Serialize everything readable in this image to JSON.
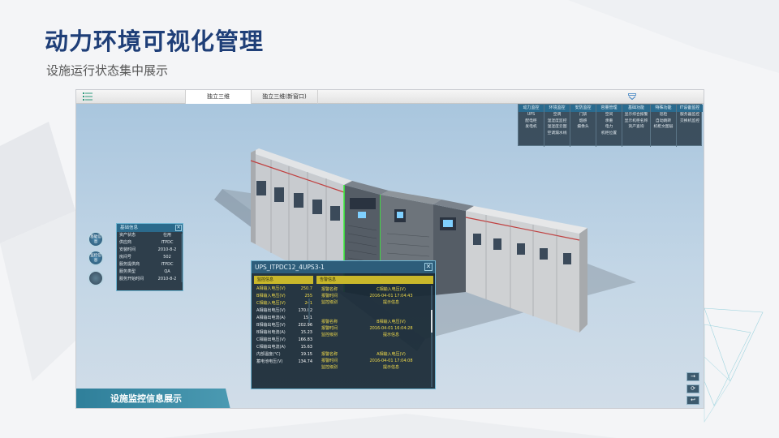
{
  "slide": {
    "title": "动力环境可视化管理",
    "subtitle": "设施运行状态集中展示"
  },
  "app": {
    "tabs": [
      {
        "label": "独立三维",
        "active": true
      },
      {
        "label": "独立三维(新窗口)",
        "active": false
      }
    ],
    "menu_icon": "list-icon",
    "collapse_icon": "chevron-down-icon",
    "topnav": [
      {
        "head": "动力监控",
        "items": [
          "UPS",
          "配电柜",
          "发电机"
        ]
      },
      {
        "head": "环境监控",
        "items": [
          "空调",
          "温湿度监控",
          "温湿度云图",
          "空调漏水线"
        ]
      },
      {
        "head": "安防监控",
        "items": [
          "门禁",
          "烟感",
          "摄像头"
        ]
      },
      {
        "head": "容量管理",
        "items": [
          "空间",
          "承重",
          "电力",
          "机柜位置"
        ]
      },
      {
        "head": "基础功能",
        "items": [
          "显示综合报警",
          "显示机柜名称",
          "资产查询"
        ]
      },
      {
        "head": "特殊功能",
        "items": [
          "巡检",
          "自动跳转",
          "机柜文图层"
        ]
      },
      {
        "head": "IT设备监控",
        "items": [
          "服务器监控",
          "交换机监控"
        ]
      }
    ],
    "basic_info": {
      "title": "基础信息",
      "rows": [
        {
          "k": "资产状态",
          "v": "在用"
        },
        {
          "k": "供应商",
          "v": "ITPDC"
        },
        {
          "k": "安装时间",
          "v": "2010-8-2"
        },
        {
          "k": "房间号",
          "v": "502"
        },
        {
          "k": "服务提供商",
          "v": "ITPDC"
        },
        {
          "k": "服务类型",
          "v": "QA"
        },
        {
          "k": "服务开始时间",
          "v": "2010-8-2"
        }
      ]
    },
    "round_buttons": [
      "基础信息",
      "监控信息",
      ""
    ],
    "ups_panel": {
      "title": "UPS_ITPDC12_4UPS3-1",
      "monitor_header": "监控信息",
      "alarm_header": "告警信息",
      "monitor_rows": [
        {
          "k": "A相输入电压(V)",
          "v": "250.7",
          "hl": true
        },
        {
          "k": "B相输入电压(V)",
          "v": "255",
          "hl": true
        },
        {
          "k": "C相输入电压(V)",
          "v": "241",
          "hl": true
        },
        {
          "k": "A相输出电压(V)",
          "v": "170.02",
          "hl": false
        },
        {
          "k": "A相输出电流(A)",
          "v": "15.1",
          "hl": false
        },
        {
          "k": "B相输出电压(V)",
          "v": "202.96",
          "hl": false
        },
        {
          "k": "B相输出电流(A)",
          "v": "15.23",
          "hl": false
        },
        {
          "k": "C相输出电压(V)",
          "v": "166.83",
          "hl": false
        },
        {
          "k": "C相输出电流(A)",
          "v": "15.63",
          "hl": false
        },
        {
          "k": "内部温度(℃)",
          "v": "19.15",
          "hl": false
        },
        {
          "k": "蓄电池电压(V)",
          "v": "134.74",
          "hl": false
        }
      ],
      "alarms": [
        [
          {
            "k": "报警名称",
            "v": "C相输入电压(V)"
          },
          {
            "k": "报警时间",
            "v": "2016-04-01 17:04:43"
          },
          {
            "k": "监控级别",
            "v": "提示信息"
          }
        ],
        [
          {
            "k": "报警名称",
            "v": "B相输入电压(V)"
          },
          {
            "k": "报警时间",
            "v": "2016-04-01 16:04:28"
          },
          {
            "k": "监控级别",
            "v": "提示信息"
          }
        ],
        [
          {
            "k": "报警名称",
            "v": "A相输入电压(V)"
          },
          {
            "k": "报警时间",
            "v": "2016-04-01 17:04:08"
          },
          {
            "k": "监控级别",
            "v": "提示信息"
          }
        ]
      ]
    },
    "banner": "设施监控信息展示",
    "controls": [
      "→",
      "⟳",
      "↩"
    ]
  }
}
